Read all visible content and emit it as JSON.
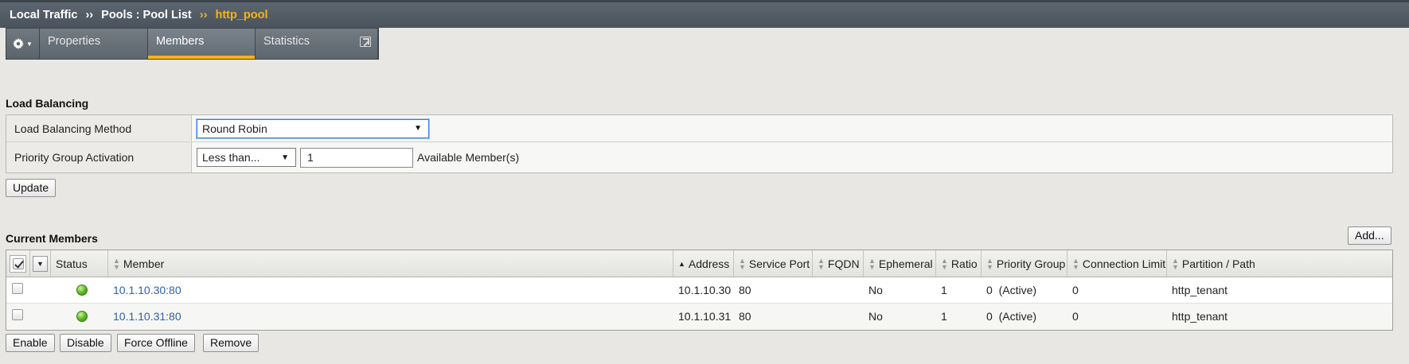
{
  "breadcrumb": {
    "items": [
      "Local Traffic",
      "Pools : Pool List"
    ],
    "current": "http_pool",
    "separator": "››"
  },
  "tabs": {
    "properties": "Properties",
    "members": "Members",
    "statistics": "Statistics",
    "active": "Members"
  },
  "load_balancing": {
    "title": "Load Balancing",
    "method_label": "Load Balancing Method",
    "method_value": "Round Robin",
    "priority_label": "Priority Group Activation",
    "priority_value": "Less than...",
    "priority_count": "1",
    "available_members": "Available Member(s)",
    "update_button": "Update"
  },
  "current_members": {
    "title": "Current Members",
    "add_button": "Add...",
    "columns": [
      "Status",
      "Member",
      "Address",
      "Service Port",
      "FQDN",
      "Ephemeral",
      "Ratio",
      "Priority Group",
      "Connection Limit",
      "Partition / Path"
    ],
    "rows": [
      {
        "member": "10.1.10.30:80",
        "address": "10.1.10.30",
        "port": "80",
        "fqdn": "",
        "ephemeral": "No",
        "ratio": "1",
        "priority_group": "0  (Active)",
        "connection_limit": "0",
        "partition": "http_tenant"
      },
      {
        "member": "10.1.10.31:80",
        "address": "10.1.10.31",
        "port": "80",
        "fqdn": "",
        "ephemeral": "No",
        "ratio": "1",
        "priority_group": "0  (Active)",
        "connection_limit": "0",
        "partition": "http_tenant"
      }
    ],
    "buttons": {
      "enable": "Enable",
      "disable": "Disable",
      "force_offline": "Force Offline",
      "remove": "Remove"
    }
  },
  "colors": {
    "header_bg": "#4f5861",
    "accent": "#f3b41a",
    "link": "#2f5fa8",
    "status_green": "#58b51c"
  }
}
